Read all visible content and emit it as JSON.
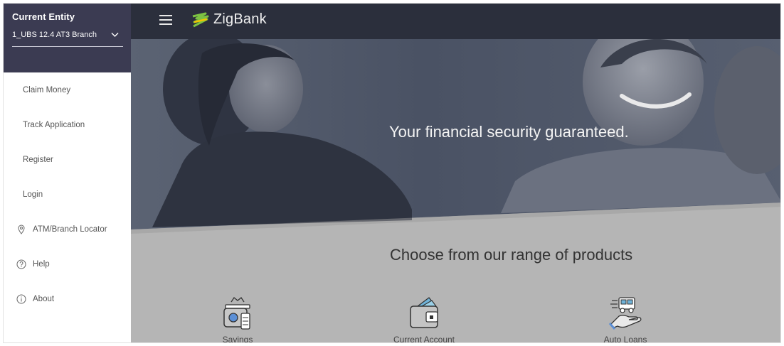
{
  "entity": {
    "title": "Current Entity",
    "selected": "1_UBS 12.4 AT3 Branch"
  },
  "menu": {
    "items": [
      {
        "label": "Claim Money"
      },
      {
        "label": "Track Application"
      },
      {
        "label": "Register"
      },
      {
        "label": "Login"
      },
      {
        "label": "ATM/Branch Locator",
        "icon": "location-pin-icon"
      },
      {
        "label": "Help",
        "icon": "help-circle-icon"
      },
      {
        "label": "About",
        "icon": "info-circle-icon"
      }
    ]
  },
  "header": {
    "brand": "ZigBank",
    "menu_icon": "hamburger-icon"
  },
  "hero": {
    "tagline": "Your financial security guaranteed."
  },
  "products": {
    "title": "Choose from our range of products",
    "items": [
      {
        "label": "Savings",
        "icon": "savings-icon"
      },
      {
        "label": "Current Account",
        "icon": "wallet-icon"
      },
      {
        "label": "Auto Loans",
        "icon": "auto-loan-icon"
      }
    ]
  },
  "colors": {
    "sidebar_header": "#3b3b52",
    "top_bar": "#2b2f3c",
    "logo_green": "#7cc242",
    "logo_yellow": "#f2c500",
    "content_gray": "#b5b5b5"
  }
}
